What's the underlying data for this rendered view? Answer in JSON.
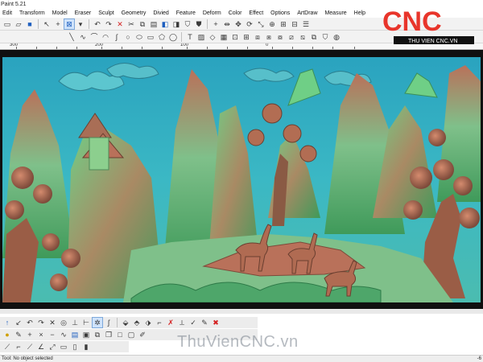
{
  "window": {
    "title": "Paint 5.21"
  },
  "menu": [
    "Edit",
    "Transform",
    "Model",
    "Eraser",
    "Sculpt",
    "Geometry",
    "Divied",
    "Feature",
    "Deform",
    "Color",
    "Effect",
    "Options",
    "ArtDraw",
    "Measure",
    "Help"
  ],
  "ruler": {
    "labels": [
      "300",
      "200",
      "100",
      "0"
    ]
  },
  "logo": {
    "brand": "CNC",
    "tagline": "THU VIEN CNC.VN",
    "accent": "#e8352b"
  },
  "watermark": "ThuVienCNC.vn",
  "status": {
    "text": "Tool: No object selected",
    "right": "-6"
  },
  "colors": {
    "relief_bg": "#3bb8c4",
    "relief_green": "#5fbf6a",
    "relief_brown": "#b9715a"
  },
  "icons": {
    "toolbar_top": [
      "file-new-icon",
      "open-icon",
      "save-icon",
      "pointer-icon",
      "crosshair-icon",
      "select-rect-icon",
      "undo-icon",
      "redo-icon",
      "delete-icon",
      "cut-icon",
      "copy-icon",
      "paste-icon",
      "box-icon",
      "layer-icon",
      "shield-icon",
      "shield-alt-icon",
      "plus-icon",
      "mirror-icon",
      "move-icon",
      "rotate-icon",
      "scale-icon",
      "combine-icon",
      "group-icon",
      "ungroup-icon",
      "align-icon"
    ],
    "toolbar_second": [
      "line-icon",
      "polyline-icon",
      "arc-icon",
      "ellipse-arc-icon",
      "spline-icon",
      "circle-icon",
      "ellipse-icon",
      "rectangle-icon",
      "polygon-icon",
      "star-icon",
      "text-icon",
      "hatch-icon",
      "node-icon",
      "grid-icon",
      "snap-icon",
      "array-icon",
      "offset-icon",
      "trim-icon",
      "join-icon",
      "break-icon",
      "fillet-icon",
      "chamfer-icon",
      "shield-icon",
      "measure-icon"
    ],
    "bottom1": [
      "arrow-up-icon",
      "curve-icon",
      "undo-curve-icon",
      "redo-curve-icon",
      "clear-icon",
      "circle-tool-icon",
      "anchor-icon",
      "branch-icon",
      "star-node-icon",
      "spiral-icon",
      "diamond-icon",
      "diamond-alt-icon",
      "diamond-b-icon",
      "knife-icon",
      "cross-red-icon",
      "split-icon",
      "check-icon",
      "close-red-icon"
    ],
    "bottom2": [
      "bulb-icon",
      "pencil-icon",
      "plus-icon",
      "cross-icon",
      "minus-icon",
      "wave-icon",
      "text-box-icon",
      "box-icon",
      "copy-icon",
      "copy-alt-icon",
      "square-icon",
      "square-alt-icon",
      "brush-icon"
    ],
    "bottom3": [
      "line-a-icon",
      "line-b-icon",
      "line-c-icon",
      "line-d-icon",
      "line-e-icon",
      "box-a-icon",
      "box-b-icon",
      "box-c-icon"
    ]
  }
}
